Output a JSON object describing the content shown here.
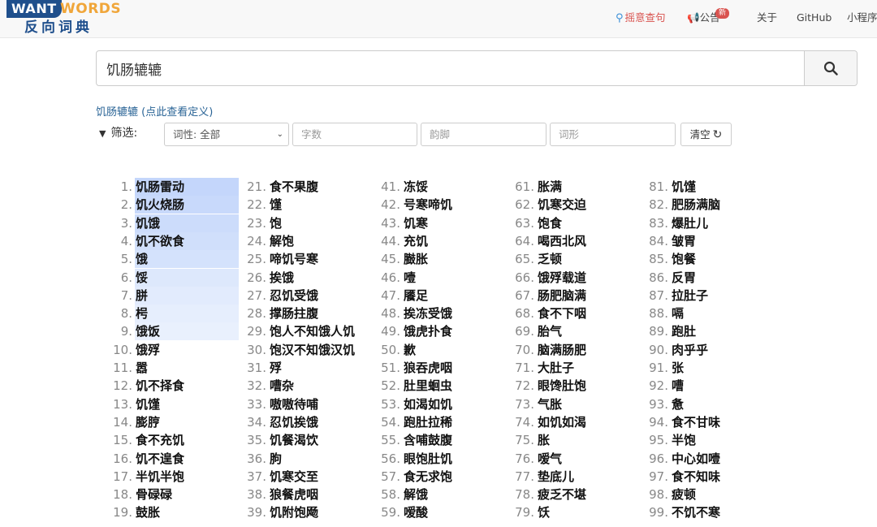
{
  "logo": {
    "want": "WANT",
    "words": "WORDS",
    "cn": "反向词典"
  },
  "nav": {
    "random": "摇意查句",
    "notice": "公告",
    "notice_badge": "新",
    "about": "关于",
    "github": "GitHub",
    "mini": "小程序"
  },
  "search": {
    "value": "饥肠辘辘",
    "placeholder": ""
  },
  "definition_link": "饥肠辘辘 (点此查看定义)",
  "filter": {
    "label": "筛选:",
    "pos_select": "词性: 全部",
    "char_count_placeholder": "字数",
    "rhyme_placeholder": "韵脚",
    "shape_placeholder": "词形",
    "clear_label": "清空"
  },
  "highlight_colors": [
    "#c4d6fb",
    "#c8d9fb",
    "#ccdcfb",
    "#d0dffb",
    "#d4e2fc",
    "#dde8fc",
    "#e2ebfd",
    "#e6eefd",
    "#e9f0fd"
  ],
  "results": {
    "columns": [
      [
        "饥肠雷动",
        "饥火烧肠",
        "饥饿",
        "饥不欲食",
        "饿",
        "馁",
        "胼",
        "枵",
        "饿饭",
        "饿殍",
        "嚣",
        "饥不择食",
        "饥馑",
        "膨脝",
        "食不充饥",
        "饥不遑食",
        "半饥半饱",
        "骨碌碌",
        "鼓胀"
      ],
      [
        "食不果腹",
        "馑",
        "饱",
        "解饱",
        "啼饥号寒",
        "挨饿",
        "忍饥受饿",
        "撑肠拄腹",
        "饱人不知饿人饥",
        "饱汉不知饿汉饥",
        "殍",
        "嘈杂",
        "嗷嗷待哺",
        "忍饥挨饿",
        "饥餐渴饮",
        "朐",
        "饥寒交至",
        "狼餐虎咽",
        "饥附饱飏"
      ],
      [
        "冻馁",
        "号寒啼饥",
        "饥寒",
        "充饥",
        "臌胀",
        "噎",
        "餍足",
        "挨冻受饿",
        "饿虎扑食",
        "歉",
        "狼吞虎咽",
        "肚里蛔虫",
        "如渴如饥",
        "跑肚拉稀",
        "含哺鼓腹",
        "眼饱肚饥",
        "食无求饱",
        "解饿",
        "嗳酸"
      ],
      [
        "胀满",
        "饥寒交迫",
        "饱食",
        "喝西北风",
        "乏顿",
        "饿殍载道",
        "肠肥脑满",
        "食不下咽",
        "胎气",
        "脑满肠肥",
        "大肚子",
        "眼馋肚饱",
        "气胀",
        "如饥如渴",
        "胀",
        "嗳气",
        "垫底儿",
        "疲乏不堪",
        "饫"
      ],
      [
        "饥馑",
        "肥肠满脑",
        "爆肚儿",
        "皱胃",
        "饱餐",
        "反胃",
        "拉肚子",
        "嗝",
        "跑肚",
        "肉乎乎",
        "张",
        "嘈",
        "惫",
        "食不甘味",
        "半饱",
        "中心如噎",
        "食不知味",
        "疲顿",
        "不饥不寒"
      ]
    ]
  }
}
